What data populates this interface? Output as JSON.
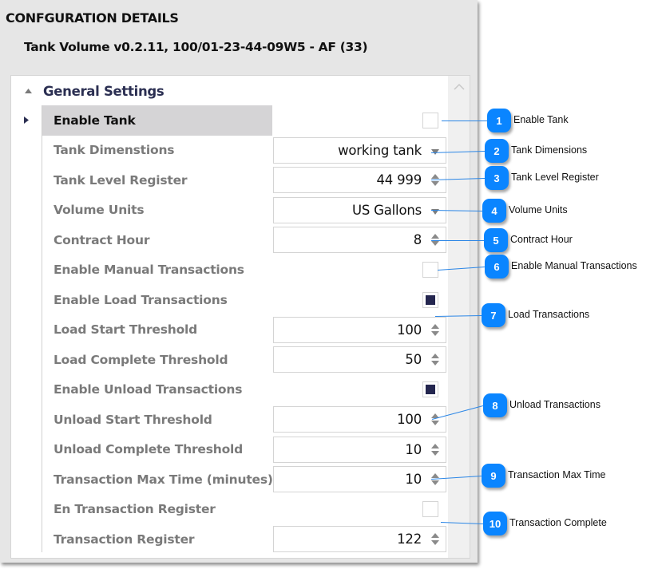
{
  "header": {
    "title": "CONFGURATION DETAILS",
    "subtitle": "Tank Volume v0.2.11, 100/01-23-44-09W5 - AF (33)"
  },
  "group": {
    "label": "General Settings",
    "expanded": true
  },
  "rows": [
    {
      "label": "Enable Tank",
      "type": "checkbox",
      "checked": false,
      "selected": true
    },
    {
      "label": "Tank Dimenstions",
      "type": "dropdown",
      "value": "working tank"
    },
    {
      "label": "Tank Level Register",
      "type": "spinner",
      "value": "44 999"
    },
    {
      "label": "Volume Units",
      "type": "dropdown",
      "value": "US Gallons"
    },
    {
      "label": "Contract Hour",
      "type": "spinner",
      "value": "8"
    },
    {
      "label": "Enable Manual Transactions",
      "type": "checkbox",
      "checked": false
    },
    {
      "label": "Enable Load Transactions",
      "type": "checkbox",
      "checked": true
    },
    {
      "label": "Load Start Threshold",
      "type": "spinner",
      "value": "100"
    },
    {
      "label": "Load Complete Threshold",
      "type": "spinner",
      "value": "50"
    },
    {
      "label": "Enable Unload Transactions",
      "type": "checkbox",
      "checked": true
    },
    {
      "label": "Unload Start Threshold",
      "type": "spinner",
      "value": "100"
    },
    {
      "label": "Unload Complete Threshold",
      "type": "spinner",
      "value": "10"
    },
    {
      "label": "Transaction Max Time (minutes)",
      "type": "spinner",
      "value": "10"
    },
    {
      "label": "En Transaction Register",
      "type": "checkbox",
      "checked": false
    },
    {
      "label": "Transaction Register",
      "type": "spinner",
      "value": "122"
    }
  ],
  "callouts": [
    {
      "number": "1",
      "text": "Enable Tank"
    },
    {
      "number": "2",
      "text": "Tank Dimensions"
    },
    {
      "number": "3",
      "text": "Tank Level Register"
    },
    {
      "number": "4",
      "text": "Volume Units"
    },
    {
      "number": "5",
      "text": "Contract Hour"
    },
    {
      "number": "6",
      "text": "Enable Manual Transactions"
    },
    {
      "number": "7",
      "text": "Load Transactions"
    },
    {
      "number": "8",
      "text": "Unload Transactions"
    },
    {
      "number": "9",
      "text": "Transaction Max Time"
    },
    {
      "number": "10",
      "text": "Transaction Complete"
    }
  ],
  "colors": {
    "callout_badge": "#0a85ff",
    "callout_line": "#2b86e6",
    "checkbox_checked": "#24264f",
    "group_label": "#2b2f52",
    "selected_row": "#d5d4d6"
  }
}
